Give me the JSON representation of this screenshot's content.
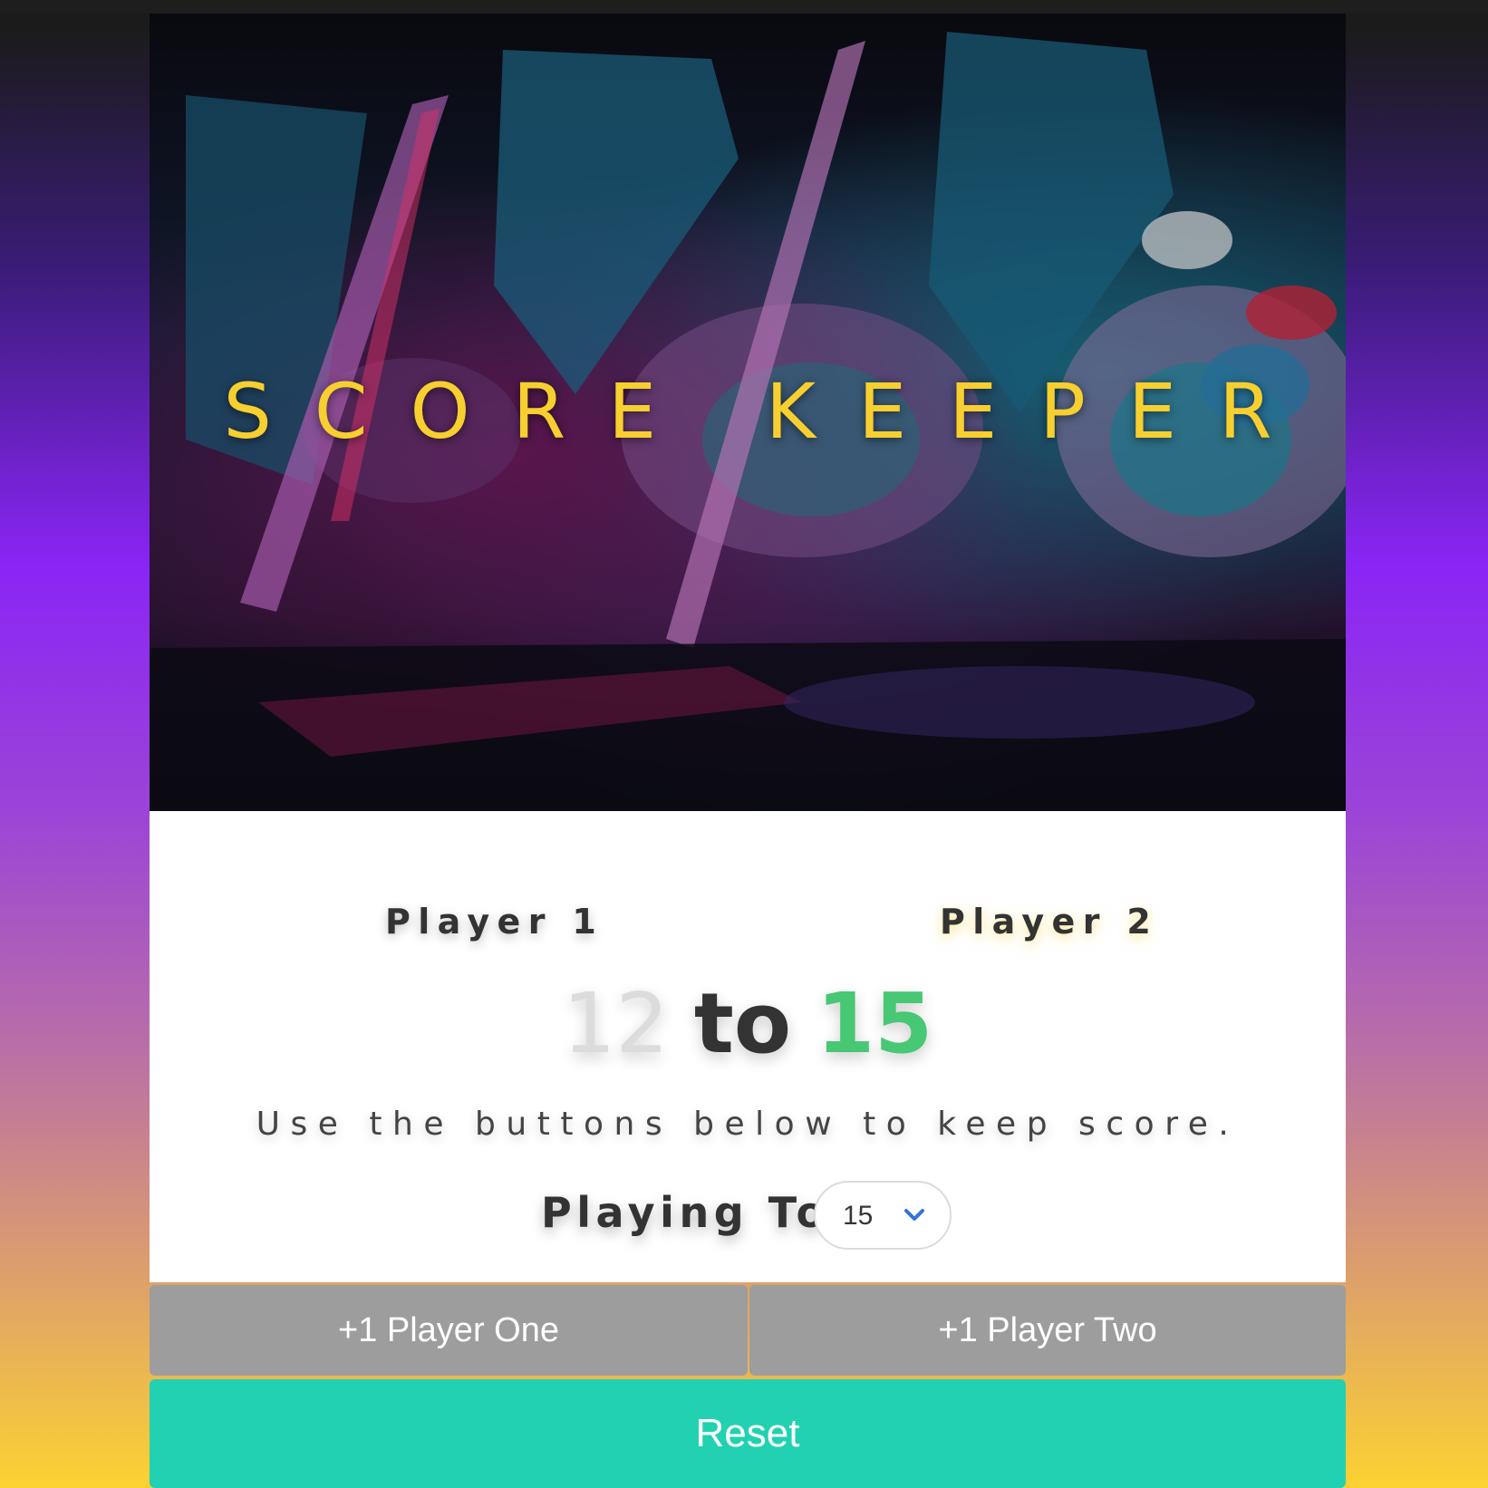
{
  "title": "SCORE KEEPER",
  "players": {
    "p1_label": "Player 1",
    "p2_label": "Player 2"
  },
  "score": {
    "p1": "12",
    "separator": "to",
    "p2": "15"
  },
  "instructions": "Use the buttons below to keep score.",
  "playing_to": {
    "label": "Playing To:",
    "selected": "15",
    "icon": "chevron-down-icon"
  },
  "buttons": {
    "p1": "+1 Player One",
    "p2": "+1 Player Two",
    "reset": "Reset"
  },
  "colors": {
    "title": "#f7cf2f",
    "winner_score": "#48c774",
    "loser_score": "#dcdcdc",
    "player_button": "#9d9d9d",
    "reset_button": "#22d1b2",
    "chevron": "#3273dc"
  }
}
